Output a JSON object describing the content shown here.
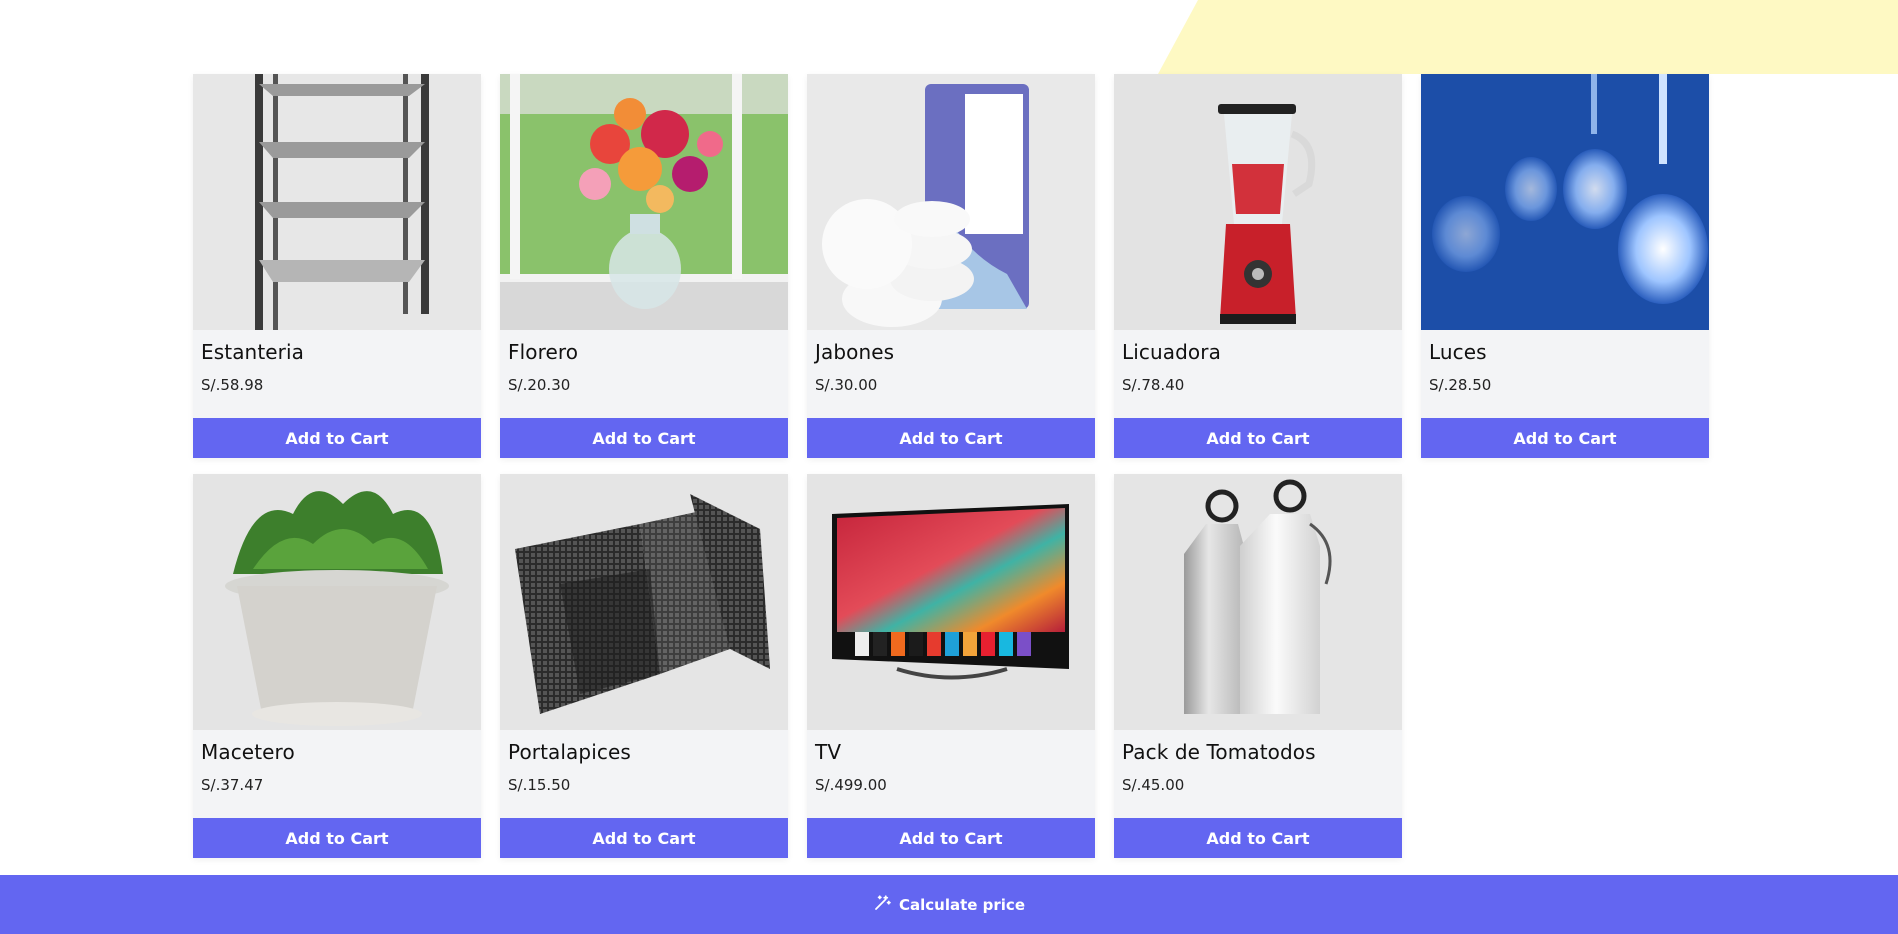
{
  "cart_label": "Add to Cart",
  "footer": {
    "calculate_label": "Calculate price"
  },
  "colors": {
    "accent": "#6366f1",
    "card_bg": "#f3f4f6",
    "banner": "#fef9c3"
  },
  "products": [
    {
      "name": "Estanteria",
      "price": "S/.58.98"
    },
    {
      "name": "Florero",
      "price": "S/.20.30"
    },
    {
      "name": "Jabones",
      "price": "S/.30.00"
    },
    {
      "name": "Licuadora",
      "price": "S/.78.40"
    },
    {
      "name": "Luces",
      "price": "S/.28.50"
    },
    {
      "name": "Macetero",
      "price": "S/.37.47"
    },
    {
      "name": "Portalapices",
      "price": "S/.15.50"
    },
    {
      "name": "TV",
      "price": "S/.499.00"
    },
    {
      "name": "Pack de Tomatodos",
      "price": "S/.45.00"
    }
  ]
}
